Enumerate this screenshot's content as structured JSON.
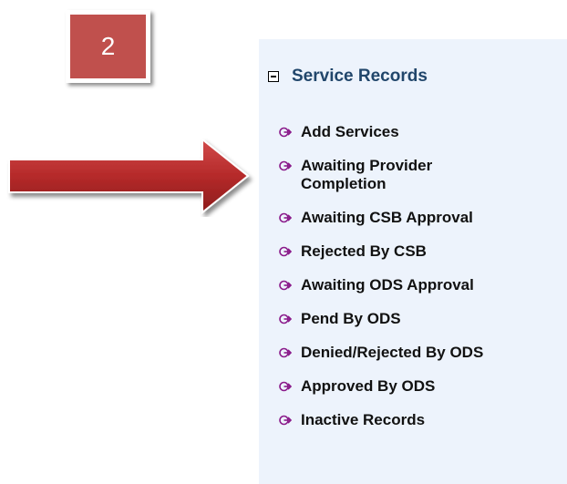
{
  "badge": {
    "number": "2",
    "color": "#c0504d"
  },
  "pointer": {
    "icon": "arrow-right-icon",
    "color": "#b52a2a"
  },
  "panel": {
    "background": "#edf3fc",
    "section": {
      "title": "Service Records",
      "toggle_icon": "collapse-minus-icon",
      "items": [
        {
          "label": "Add Services",
          "icon": "arrow-circle-icon"
        },
        {
          "label": "Awaiting Provider\nCompletion",
          "icon": "arrow-circle-icon"
        },
        {
          "label": "Awaiting CSB Approval",
          "icon": "arrow-circle-icon"
        },
        {
          "label": "Rejected By CSB",
          "icon": "arrow-circle-icon"
        },
        {
          "label": "Awaiting ODS Approval",
          "icon": "arrow-circle-icon"
        },
        {
          "label": "Pend By ODS",
          "icon": "arrow-circle-icon"
        },
        {
          "label": "Denied/Rejected By ODS",
          "icon": "arrow-circle-icon"
        },
        {
          "label": "Approved By ODS",
          "icon": "arrow-circle-icon"
        },
        {
          "label": "Inactive Records",
          "icon": "arrow-circle-icon"
        }
      ]
    }
  }
}
